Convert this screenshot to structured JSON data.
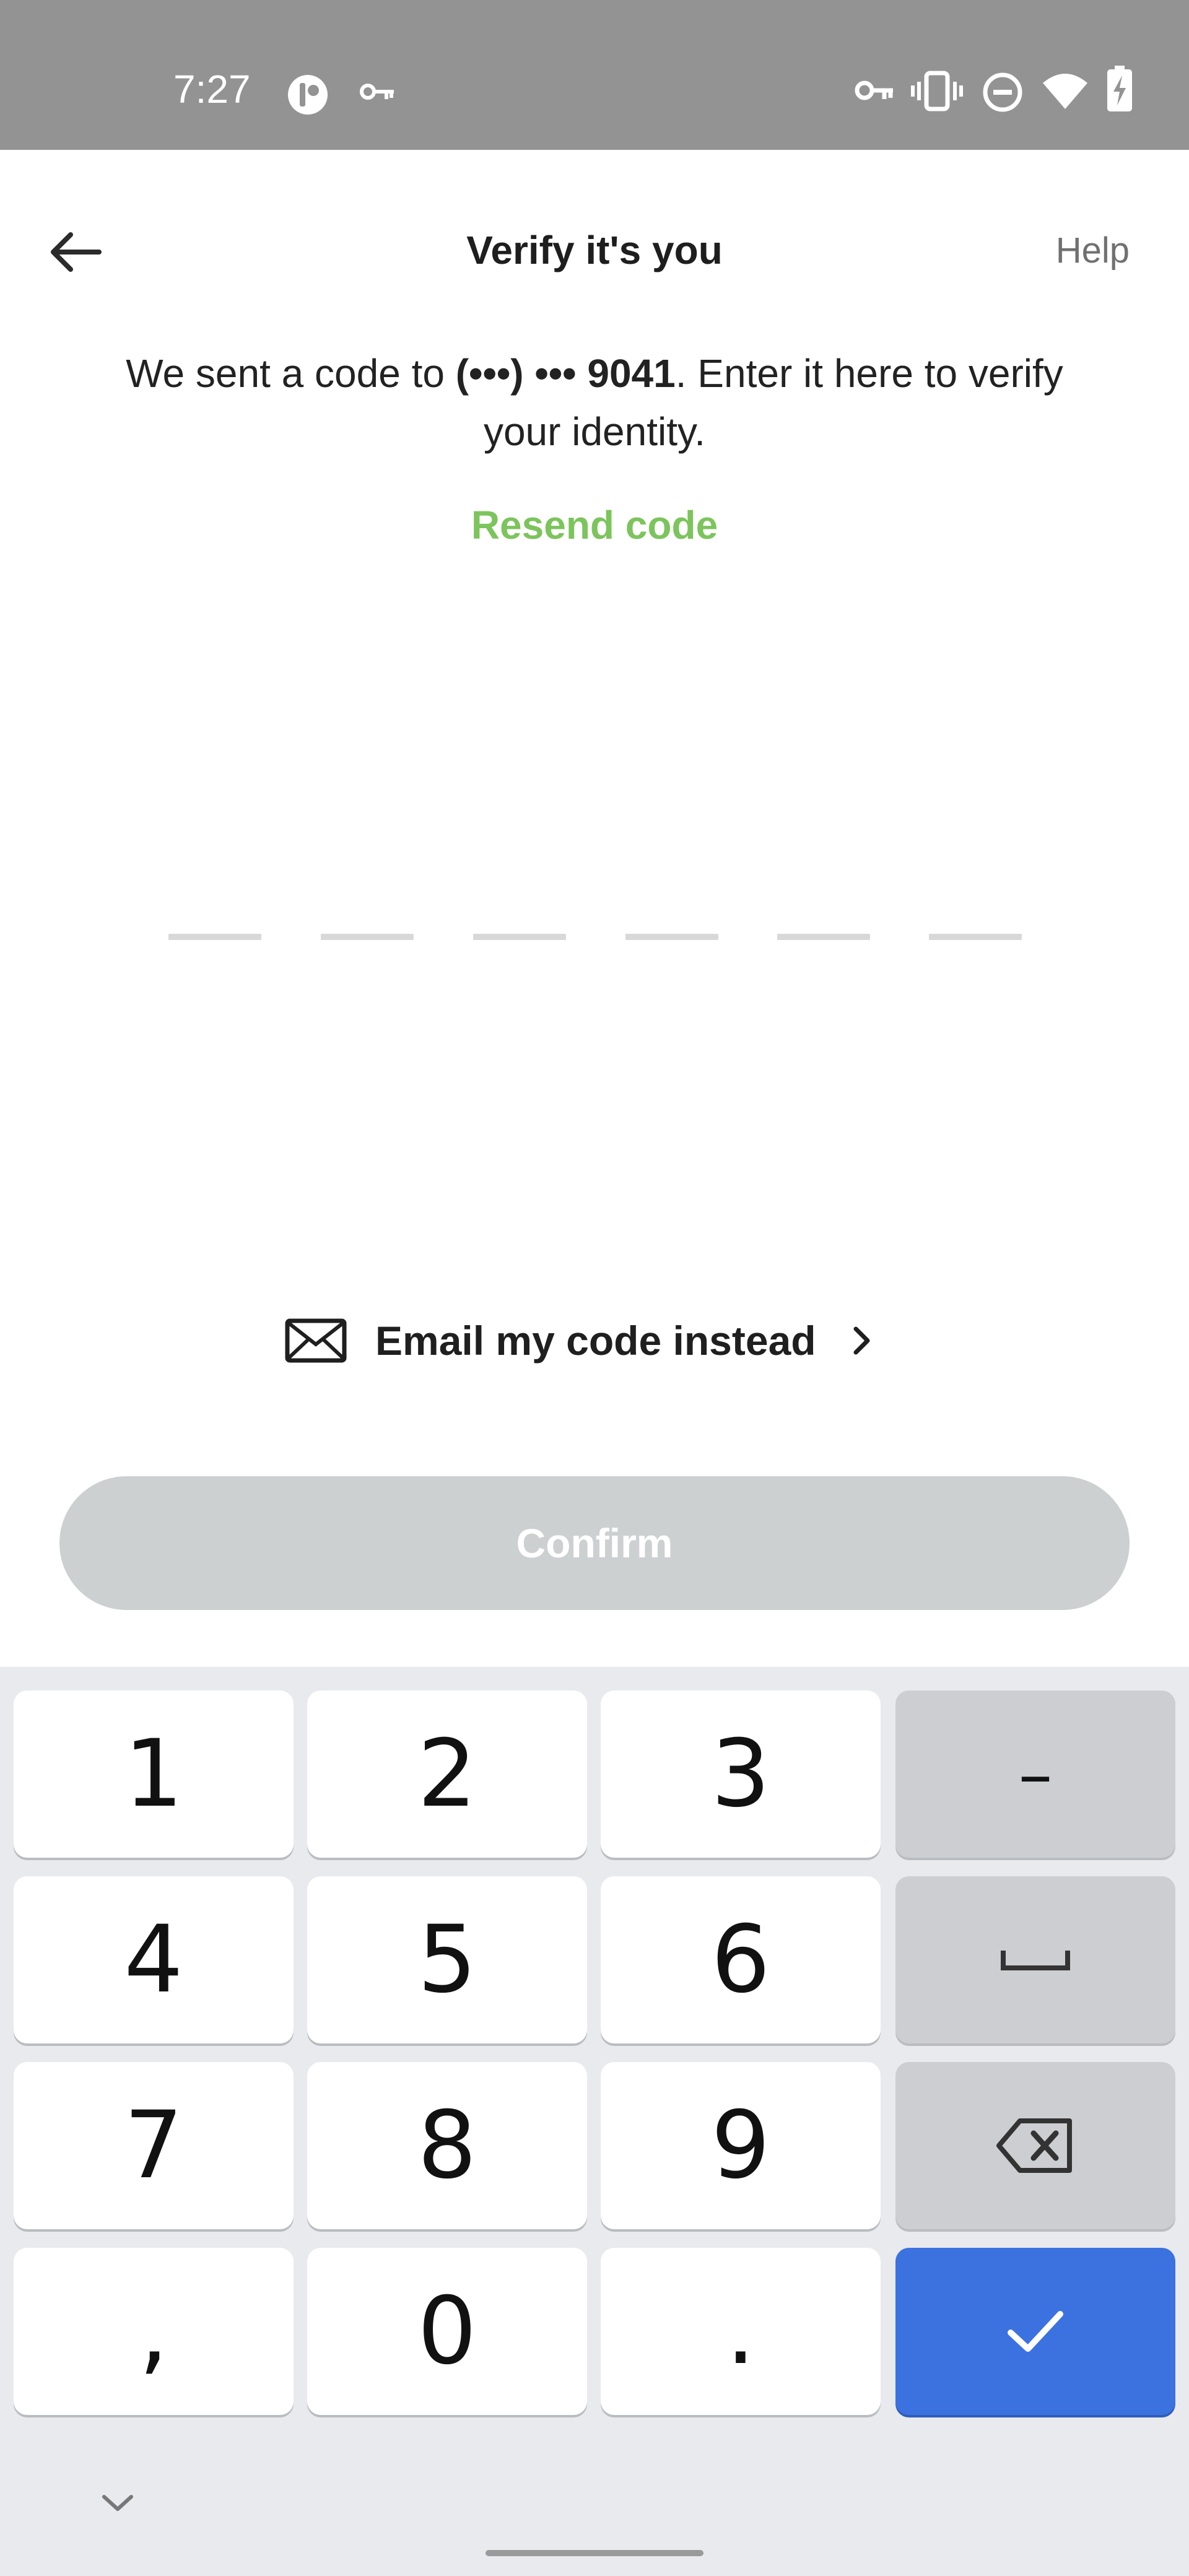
{
  "status_bar": {
    "time": "7:27",
    "icons": [
      "app-notification-icon",
      "vpn-key-icon",
      "key-icon",
      "vibrate-icon",
      "do-not-disturb-icon",
      "wifi-icon",
      "battery-charging-icon"
    ],
    "background": "#939393"
  },
  "header": {
    "back_icon": "arrow-left-icon",
    "title": "Verify it's you",
    "help_label": "Help"
  },
  "instructions": {
    "prefix": "We sent a code to ",
    "phone": "(•••) ••• 9041",
    "suffix": ". Enter it here to verify your identity."
  },
  "resend": {
    "label": "Resend code",
    "color": "#7cc45c"
  },
  "code_input": {
    "length": 6,
    "digits": [
      "",
      "",
      "",
      "",
      "",
      ""
    ]
  },
  "email_option": {
    "icon": "envelope-icon",
    "label": "Email my code instead",
    "chevron": "chevron-right-icon"
  },
  "confirm": {
    "label": "Confirm",
    "enabled": false
  },
  "keyboard": {
    "keys": [
      "1",
      "2",
      "3",
      "–",
      "4",
      "5",
      "6",
      "space",
      "7",
      "8",
      "9",
      "backspace",
      ",",
      "0",
      ".",
      "done"
    ],
    "labels": {
      "k1": "1",
      "k2": "2",
      "k3": "3",
      "dash": "–",
      "k4": "4",
      "k5": "5",
      "k6": "6",
      "k7": "7",
      "k8": "8",
      "k9": "9",
      "comma": ",",
      "k0": "0",
      "period": "."
    },
    "accent": "#3b72e0"
  }
}
